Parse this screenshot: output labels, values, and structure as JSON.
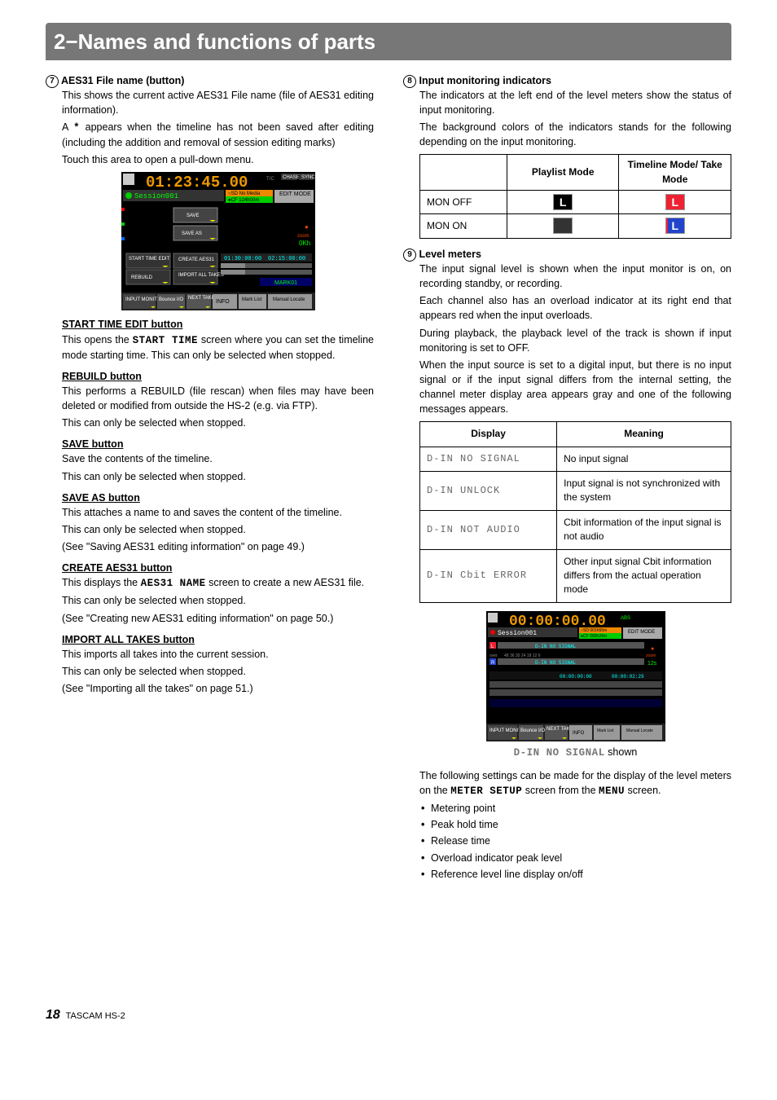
{
  "chapter_title": "2−Names and functions of parts",
  "footer": {
    "page": "18",
    "product": "TASCAM HS-2"
  },
  "item7": {
    "num": "7",
    "title": "AES31 File name (button)",
    "p1": "This shows the current active AES31 File name (file of AES31 editing information).",
    "p2a": "A ",
    "p2_symbol": "*",
    "p2b": " appears when the timeline has not been saved after editing (including the addition and removal of session editing marks)",
    "p3": "Touch this area to open a pull-down menu.",
    "fig": {
      "session": "Session001",
      "cf_label": "CF",
      "cf_value": "124h00m",
      "sd_label": "SD",
      "sd_value": "No Media",
      "edit_mode": "EDIT MODE",
      "time": "01:23:45.00",
      "tc": "T/C",
      "tb1": "02:15:00:00",
      "tb0": "01:30:00:00",
      "mark": "MARK01",
      "chase": "CHASE",
      "sync": "SYNC",
      "buttons": {
        "start_time": "START TIME EDIT",
        "rebuild": "REBUILD",
        "save": "SAVE",
        "save_as": "SAVE AS",
        "create": "CREATE AES31",
        "import": "IMPORT ALL TAKES"
      },
      "toolbar": {
        "input_monitor": "INPUT MONITOR",
        "bounce": "Bounce I/O",
        "next": "NEXT TAKE NAME",
        "info": "INFO",
        "mark": "Mark List",
        "manual": "Manual Locate"
      },
      "axis": "0Kh",
      "zoom": "zoom"
    },
    "start_time_h": "START TIME EDIT button",
    "start_time_p1a": "This opens the ",
    "start_time_fixed": "START TIME",
    "start_time_p1b": " screen where you can set the timeline mode starting time. This can only be selected when stopped.",
    "rebuild_h": "REBUILD button",
    "rebuild_p1": "This performs a REBUILD (file rescan) when files may have been deleted or modified from outside the HS-2 (e.g. via FTP).",
    "rebuild_p2": "This can only be selected when stopped.",
    "save_h": "SAVE button",
    "save_p1": "Save the contents of the timeline.",
    "save_p2": "This can only be selected when stopped.",
    "saveas_h": "SAVE AS button",
    "saveas_p1": "This attaches a name to and saves the content of the timeline.",
    "saveas_p2": "This can only be selected when stopped.",
    "saveas_p3": "(See \"Saving AES31 editing information\" on page 49.)",
    "create_h": "CREATE AES31 button",
    "create_p1a": "This displays the ",
    "create_fixed": "AES31 NAME",
    "create_p1b": " screen to create a new AES31 file.",
    "create_p2": "This can only be selected when stopped.",
    "create_p3": "(See \"Creating new AES31 editing information\" on page 50.)",
    "import_h": "IMPORT ALL TAKES button",
    "import_p1": "This imports all takes into the current session.",
    "import_p2": "This can only be selected when stopped.",
    "import_p3": "(See \"Importing all the takes\" on page 51.)"
  },
  "item8": {
    "num": "8",
    "title": "Input monitoring indicators",
    "p1": "The indicators at the left end of the level meters show the status of input monitoring.",
    "p2": "The background colors of the indicators stands for the following depending on the input monitoring.",
    "table": {
      "h1": "",
      "h2": "Playlist Mode",
      "h3": "Timeline Mode/ Take Mode",
      "r1": "MON OFF",
      "r2": "MON ON"
    }
  },
  "item9": {
    "num": "9",
    "title": "Level meters",
    "p1": "The input signal level is shown when the input monitor is on, on recording standby, or recording.",
    "p2": "Each channel also has an overload indicator at its right end that appears red when the input overloads.",
    "p3": "During playback, the playback level of the track is shown if input monitoring is set to OFF.",
    "p4": "When the input source is set to a digital input, but there is no input signal or if the input signal differs from the internal setting, the channel meter display area appears gray and one of the following messages appears.",
    "table": {
      "h1": "Display",
      "h2": "Meaning",
      "r1d": "D-IN NO SIGNAL",
      "r1m": "No input signal",
      "r2d": "D-IN UNLOCK",
      "r2m": "Input signal is not synchronized with the system",
      "r3d": "D-IN NOT AUDIO",
      "r3m": "Cbit information of the input signal is not audio",
      "r4d": "D-IN Cbit ERROR",
      "r4m": "Other input signal Cbit information differs from the actual operation mode"
    },
    "fig": {
      "session": "Session001",
      "sd": "SD",
      "sd_val": "001h55m",
      "cf": "CF",
      "cf_val": "000h24m",
      "edit": "EDIT MODE",
      "time": "00:00:00.00",
      "abs": "ABS",
      "signal": "D-IN NO SIGNAL",
      "over": "over",
      "ticks": "48  36    30    24    18    12    6",
      "zoom": "zoom",
      "axis": "12s",
      "tb0": "00:00:00:00",
      "tb1": "00:00:02:29"
    },
    "caption_a": "D-IN NO SIGNAL",
    "caption_b": " shown",
    "p5a": "The following settings can be made for the display of the level meters on the ",
    "p5_fixed1": "METER SETUP",
    "p5b": " screen from the ",
    "p5_fixed2": "MENU",
    "p5c": " screen.",
    "bullets": {
      "b1": "Metering point",
      "b2": "Peak hold time",
      "b3": "Release time",
      "b4": "Overload indicator peak level",
      "b5": "Reference level line display on/off"
    }
  }
}
